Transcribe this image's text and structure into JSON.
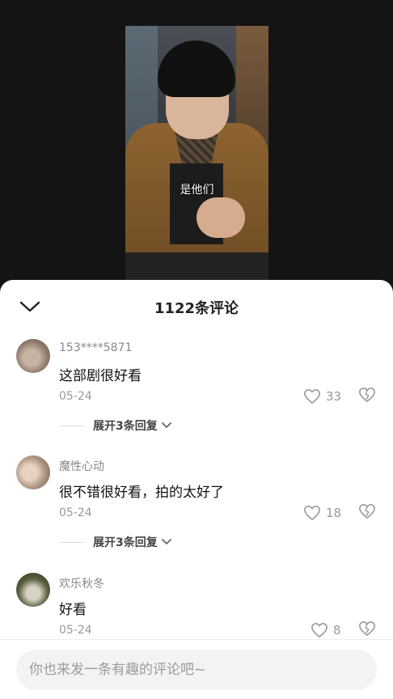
{
  "video": {
    "subtitle": "是他们"
  },
  "comments_panel": {
    "title": "1122条评论",
    "collapse_icon": "chevron-down-icon",
    "comments": [
      {
        "username": "153****5871",
        "text": "这部剧很好看",
        "date": "05-24",
        "likes": "33",
        "expand_label": "展开3条回复"
      },
      {
        "username": "魔性心动",
        "text": "很不错很好看，拍的太好了",
        "date": "05-24",
        "likes": "18",
        "expand_label": "展开3条回复"
      },
      {
        "username": "欢乐秋冬",
        "text": "好看",
        "date": "05-24",
        "likes": "8"
      }
    ]
  },
  "input": {
    "placeholder": "你也来发一条有趣的评论吧~"
  },
  "colors": {
    "sheet_bg": "#ffffff",
    "page_bg": "#121212",
    "muted_text": "#999999",
    "input_bg": "#f3f3f3"
  }
}
